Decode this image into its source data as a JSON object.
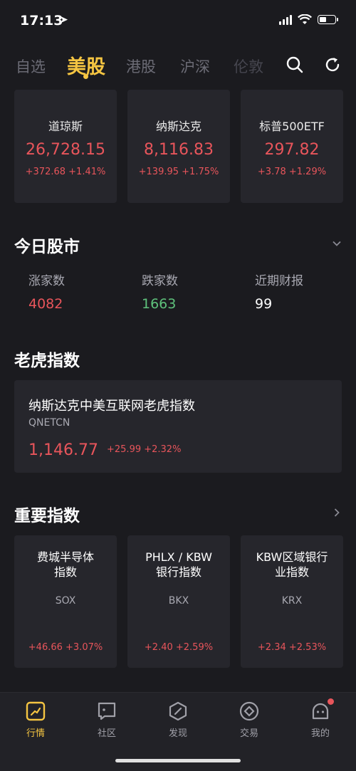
{
  "status": {
    "time": "17:13"
  },
  "tabs": [
    {
      "label": "自选"
    },
    {
      "label": "美股"
    },
    {
      "label": "港股"
    },
    {
      "label": "沪深"
    },
    {
      "label": "伦敦"
    }
  ],
  "indices": [
    {
      "name": "道琼斯",
      "value": "26,728.15",
      "change": "+372.68 +1.41%"
    },
    {
      "name": "纳斯达克",
      "value": "8,116.83",
      "change": "+139.95 +1.75%"
    },
    {
      "name": "标普500ETF",
      "value": "297.82",
      "change": "+3.78 +1.29%"
    }
  ],
  "today": {
    "title": "今日股市",
    "stats": [
      {
        "label": "涨家数",
        "value": "4082",
        "color": "#e8555b"
      },
      {
        "label": "跌家数",
        "value": "1663",
        "color": "#5fc27c"
      },
      {
        "label": "近期财报",
        "value": "99",
        "color": "#ffffff"
      }
    ]
  },
  "tiger": {
    "title": "老虎指数",
    "name": "纳斯达克中美互联网老虎指数",
    "code": "QNETCN",
    "value": "1,146.77",
    "change": "+25.99 +2.32%"
  },
  "important": {
    "title": "重要指数",
    "items": [
      {
        "name_line1": "费城半导体",
        "name_line2": "指数",
        "code": "SOX",
        "change": "+46.66 +3.07%"
      },
      {
        "name_line1": "PHLX / KBW",
        "name_line2": "银行指数",
        "code": "BKX",
        "change": "+2.40 +2.59%"
      },
      {
        "name_line1": "KBW区域银行",
        "name_line2": "业指数",
        "code": "KRX",
        "change": "+2.34 +2.53%"
      }
    ]
  },
  "nav": [
    {
      "label": "行情",
      "icon": "chart-icon"
    },
    {
      "label": "社区",
      "icon": "community-icon"
    },
    {
      "label": "发现",
      "icon": "discover-icon"
    },
    {
      "label": "交易",
      "icon": "trade-icon"
    },
    {
      "label": "我的",
      "icon": "profile-icon"
    }
  ],
  "colors": {
    "accent": "#f5c542",
    "up": "#e8555b",
    "down": "#5fc27c",
    "background": "#1b1b1f",
    "card": "#26262c"
  }
}
